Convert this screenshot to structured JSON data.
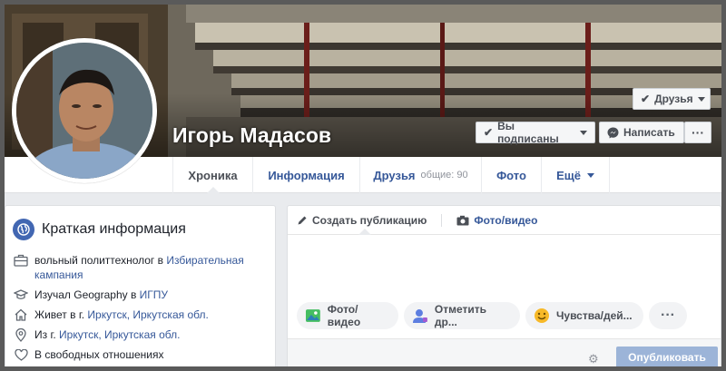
{
  "profile": {
    "name": "Игорь Мадасов"
  },
  "buttons": {
    "friends": "Друзья",
    "subscribed": "Вы подписаны",
    "message": "Написать",
    "more": "···"
  },
  "nav": {
    "tabs": [
      {
        "label": "Хроника",
        "active": true
      },
      {
        "label": "Информация"
      },
      {
        "label": "Друзья",
        "count": "общие: 90"
      },
      {
        "label": "Фото"
      },
      {
        "label": "Ещё"
      }
    ]
  },
  "intro": {
    "title": "Краткая информация",
    "work": {
      "text": "вольный политтехнолог в ",
      "link": "Избирательная кампания"
    },
    "study": {
      "text": "Изучал Geography в ",
      "link": "ИГПУ"
    },
    "lives": {
      "text": "Живет в г. ",
      "link": "Иркутск, Иркутская обл."
    },
    "from": {
      "text": "Из г. ",
      "link": "Иркутск, Иркутская обл."
    },
    "relationship": "В свободных отношениях"
  },
  "composer": {
    "tabs": {
      "create": "Создать публикацию",
      "photo": "Фото/видео"
    },
    "actions": {
      "photo": "Фото/видео",
      "tag": "Отметить др...",
      "feeling": "Чувства/дей...",
      "more": "···"
    },
    "publish": "Опубликовать"
  },
  "colors": {
    "fb_blue": "#365899",
    "accent": "#4267b2",
    "publish_disabled": "#9cb4d8"
  }
}
